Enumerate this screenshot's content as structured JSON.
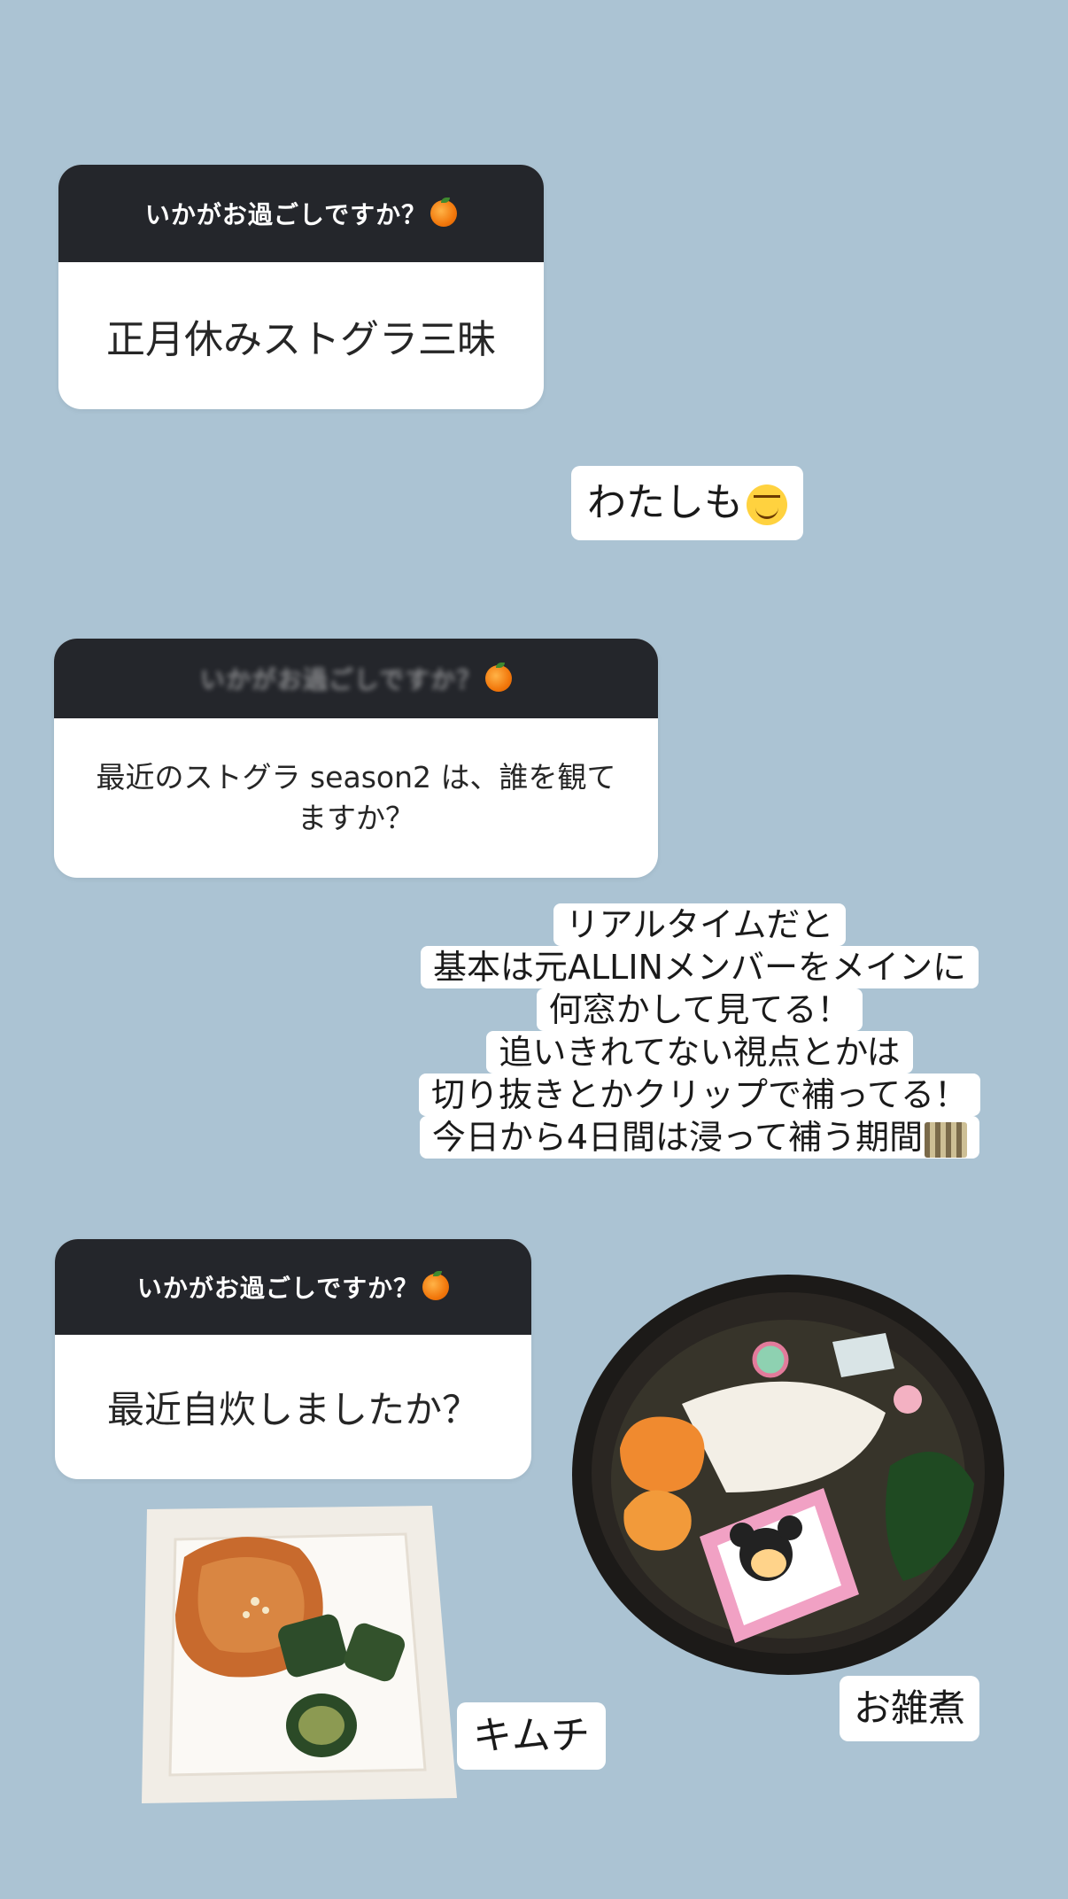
{
  "cards": [
    {
      "header": "いかがお過ごしですか？",
      "question": "正月休みストグラ三昧"
    },
    {
      "header": "いかがお過ごしですか？",
      "question": "最近のストグラ season2 は、誰を観てますか？"
    },
    {
      "header": "いかがお過ごしですか？",
      "question": "最近自炊しましたか？"
    }
  ],
  "replies": {
    "first": "わたしも",
    "multiline": [
      "リアルタイムだと",
      "基本は元ALLINメンバーをメインに",
      "何窓かして見てる！",
      "追いきれてない視点とかは",
      "切り抜きとかクリップで補ってる！",
      "今日から4日間は浸って補う期間"
    ],
    "kimchi_label": "キムチ",
    "ozoni_label": "お雑煮"
  },
  "icons": {
    "header_emoji": "tangerine-icon",
    "smile_emoji": "smiling-face-icon",
    "film_emoji": "film-strip-icon"
  },
  "colors": {
    "background": "#abc3d3",
    "card_header": "#24262b",
    "card_body": "#ffffff"
  }
}
